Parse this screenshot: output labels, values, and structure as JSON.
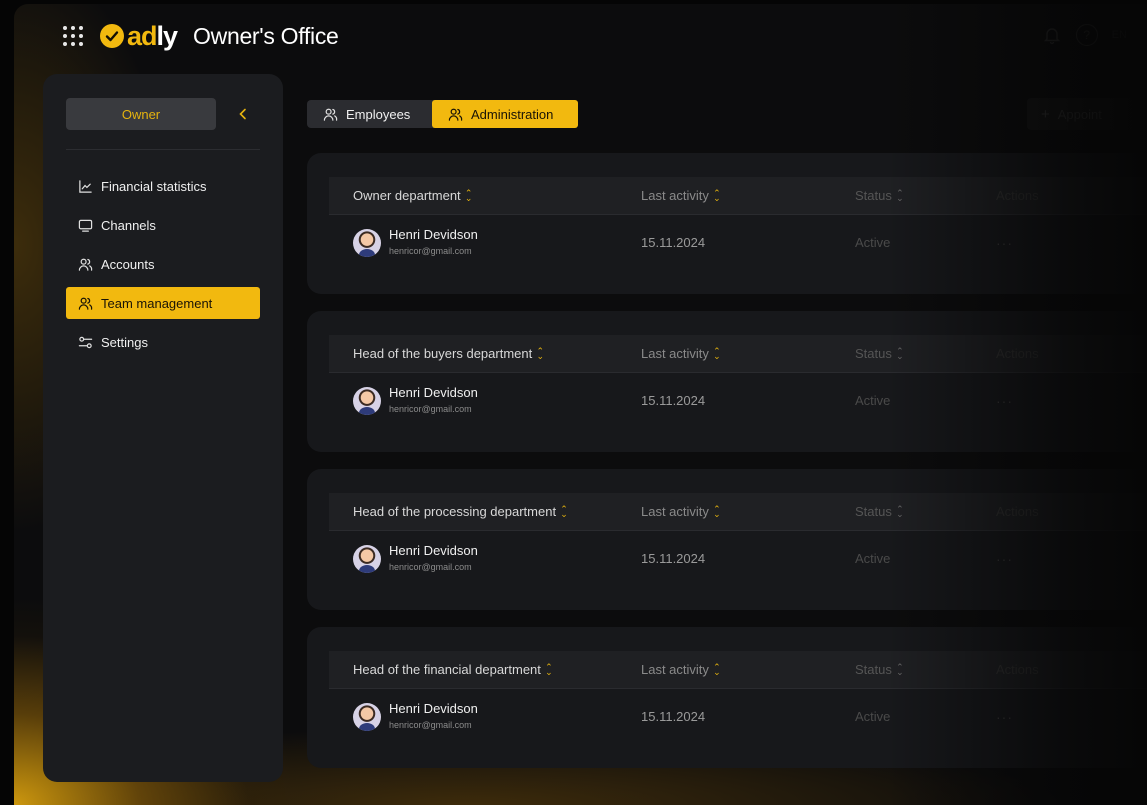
{
  "header": {
    "logo_prefix": "ad",
    "logo_suffix": "ly",
    "title": "Owner's Office",
    "lang": "EN"
  },
  "sidebar": {
    "role": "Owner",
    "collapse": "<",
    "items": [
      {
        "label": "Financial statistics",
        "icon": "chart-icon",
        "active": false
      },
      {
        "label": "Channels",
        "icon": "monitor-icon",
        "active": false
      },
      {
        "label": "Accounts",
        "icon": "users-icon",
        "active": false
      },
      {
        "label": "Team management",
        "icon": "users-icon",
        "active": true
      },
      {
        "label": "Settings",
        "icon": "sliders-icon",
        "active": false
      }
    ]
  },
  "tabs": [
    {
      "label": "Employees",
      "active": false
    },
    {
      "label": "Administration",
      "active": true
    }
  ],
  "appoint_button": {
    "label": "Appoint",
    "icon": "+"
  },
  "columns": {
    "last_activity": "Last activity",
    "status": "Status",
    "actions": "Actions"
  },
  "departments": [
    {
      "title": "Owner department",
      "member": {
        "name": "Henri Devidson",
        "email": "henricor@gmail.com",
        "last_activity": "15.11.2024",
        "status": "Active",
        "actions": "···"
      }
    },
    {
      "title": "Head of the buyers department",
      "member": {
        "name": "Henri Devidson",
        "email": "henricor@gmail.com",
        "last_activity": "15.11.2024",
        "status": "Active",
        "actions": "···"
      }
    },
    {
      "title": "Head of the processing department",
      "member": {
        "name": "Henri Devidson",
        "email": "henricor@gmail.com",
        "last_activity": "15.11.2024",
        "status": "Active",
        "actions": "···"
      }
    },
    {
      "title": "Head of the financial department",
      "member": {
        "name": "Henri Devidson",
        "email": "henricor@gmail.com",
        "last_activity": "15.11.2024",
        "status": "Active",
        "actions": "···"
      }
    }
  ],
  "colors": {
    "accent": "#f2b90f",
    "background": "#0c0c0d",
    "panel": "#1b1c1f"
  }
}
